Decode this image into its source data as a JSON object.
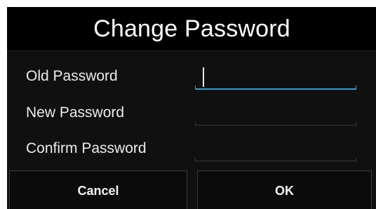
{
  "dialog": {
    "title": "Change Password",
    "fields": [
      {
        "label": "Old Password",
        "value": "",
        "focused": true
      },
      {
        "label": "New Password",
        "value": "",
        "focused": false
      },
      {
        "label": "Confirm Password",
        "value": "",
        "focused": false
      }
    ],
    "buttons": {
      "cancel_label": "Cancel",
      "ok_label": "OK"
    },
    "colors": {
      "accent": "#2b9fd6",
      "background": "#101010",
      "title_background": "#000000",
      "text": "#ececec"
    }
  }
}
